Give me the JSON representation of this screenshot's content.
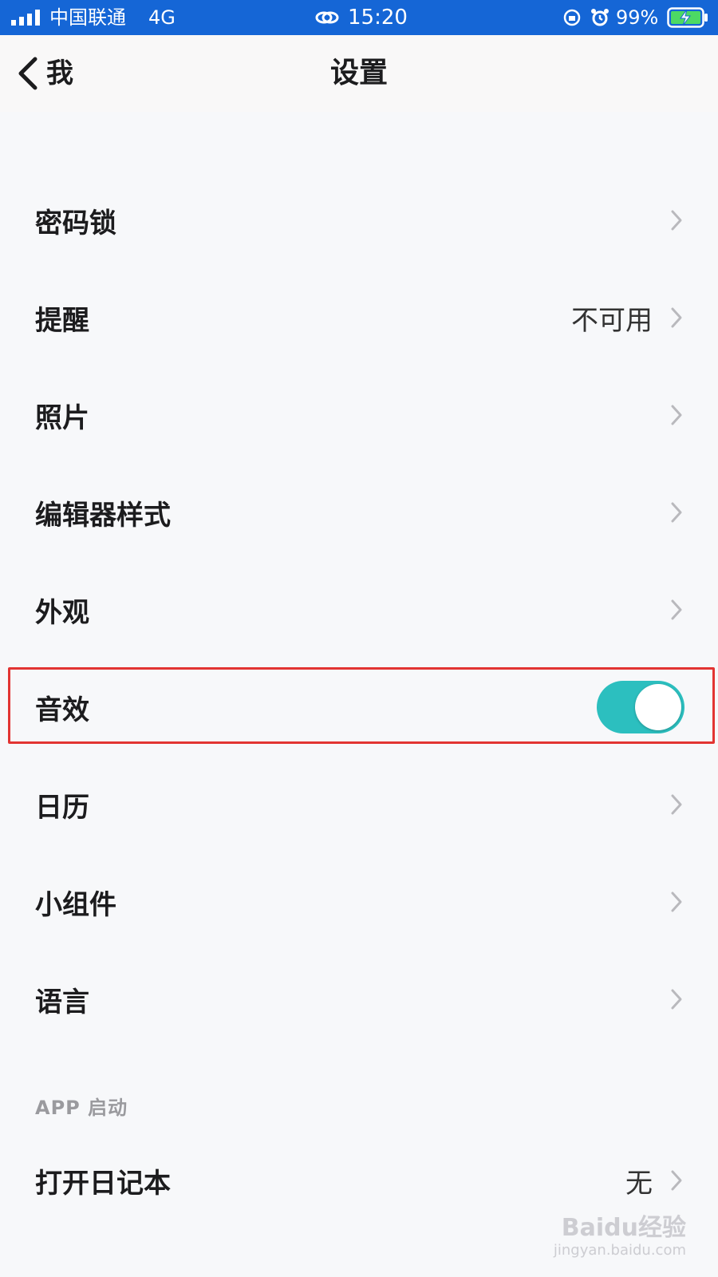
{
  "status_bar": {
    "carrier": "中国联通",
    "network": "4G",
    "time": "15:20",
    "battery_percent": "99%",
    "icons": [
      "signal-icon",
      "link-icon",
      "rotation-lock-icon",
      "alarm-icon",
      "battery-charging-icon"
    ]
  },
  "nav": {
    "back_label": "我",
    "title": "设置"
  },
  "settings": {
    "items": [
      {
        "label": "密码锁",
        "value": ""
      },
      {
        "label": "提醒",
        "value": "不可用"
      },
      {
        "label": "照片",
        "value": ""
      },
      {
        "label": "编辑器样式",
        "value": ""
      },
      {
        "label": "外观",
        "value": ""
      },
      {
        "label": "音效",
        "value": "",
        "toggle_on": true
      },
      {
        "label": "日历",
        "value": ""
      },
      {
        "label": "小组件",
        "value": ""
      },
      {
        "label": "语言",
        "value": ""
      }
    ]
  },
  "app_launch": {
    "section_title": "APP 启动",
    "item_label": "打开日记本",
    "item_value": "无"
  },
  "watermark": {
    "main": "Baidu经验",
    "sub": "jingyan.baidu.com"
  },
  "colors": {
    "status_bar_bg": "#1566d6",
    "toggle_on": "#2cbfbf",
    "highlight": "#e23432"
  }
}
